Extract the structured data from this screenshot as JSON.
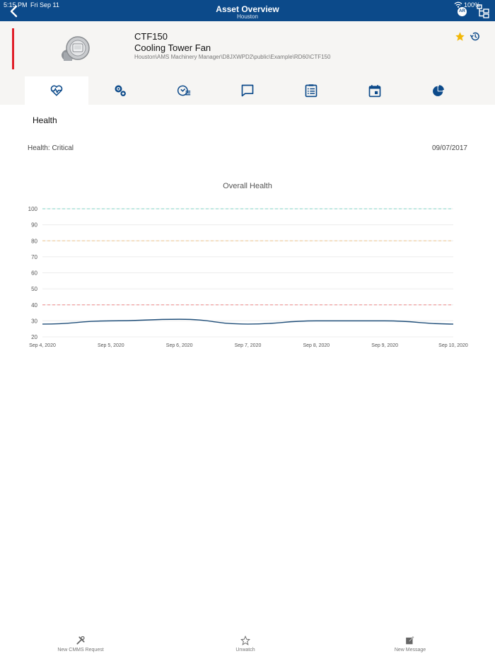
{
  "status_bar": {
    "time": "5:15 PM",
    "date": "Fri Sep 11",
    "battery": "100%",
    "ar_badge": "AR"
  },
  "nav": {
    "title": "Asset Overview",
    "subtitle": "Houston"
  },
  "asset": {
    "id": "CTF150",
    "name": "Cooling Tower Fan",
    "path": "Houston\\AMS Machinery Manager\\D8JXWPD2\\public\\Example\\RD60\\CTF150",
    "alert_color": "#e0202a",
    "favorite_color": "#f2b705"
  },
  "tabs": [
    {
      "icon": "heartbeat-icon",
      "active": true
    },
    {
      "icon": "gears-icon",
      "active": false
    },
    {
      "icon": "gauge-list-icon",
      "active": false
    },
    {
      "icon": "message-icon",
      "active": false
    },
    {
      "icon": "checklist-icon",
      "active": false
    },
    {
      "icon": "calendar-icon",
      "active": false
    },
    {
      "icon": "pie-chart-icon",
      "active": false
    }
  ],
  "section": {
    "title": "Health"
  },
  "health": {
    "status": "Health: Critical",
    "date": "09/07/2017"
  },
  "chart_data": {
    "type": "line",
    "title": "Overall Health",
    "categories": [
      "Sep 4, 2020",
      "Sep 5, 2020",
      "Sep 6, 2020",
      "Sep 7, 2020",
      "Sep 8, 2020",
      "Sep 9, 2020",
      "Sep 10, 2020"
    ],
    "series": [
      {
        "values": [
          28,
          30,
          31,
          28,
          30,
          30,
          28
        ],
        "color": "#1f4e79"
      }
    ],
    "ylim": [
      20,
      100
    ],
    "yticks": [
      20,
      30,
      40,
      50,
      60,
      70,
      80,
      90,
      100
    ],
    "threshold_lines": [
      {
        "value": 100,
        "color": "#7fd3c6"
      },
      {
        "value": 80,
        "color": "#f0c890"
      },
      {
        "value": 40,
        "color": "#f08a8a"
      }
    ],
    "grid": true
  },
  "bottom_bar": [
    {
      "label": "New CMMS Request",
      "icon": "tools-icon"
    },
    {
      "label": "Unwatch",
      "icon": "star-outline-icon"
    },
    {
      "label": "New Message",
      "icon": "compose-icon"
    }
  ],
  "colors": {
    "nav_bg": "#0c4a8a",
    "accent": "#0c4a8a"
  }
}
